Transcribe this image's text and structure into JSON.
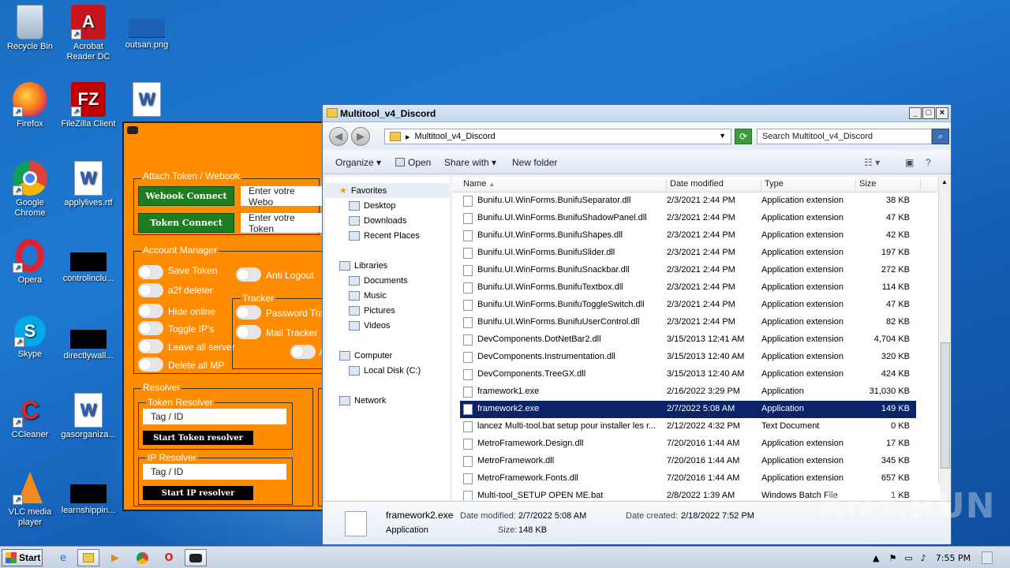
{
  "desktop": {
    "icons": [
      {
        "label": "Recycle Bin"
      },
      {
        "label": "Acrobat Reader DC"
      },
      {
        "label": "outsan.png"
      },
      {
        "label": "Firefox"
      },
      {
        "label": "FileZilla Client"
      },
      {
        "label": "Google Chrome"
      },
      {
        "label": "applylives.rtf"
      },
      {
        "label": "Opera"
      },
      {
        "label": "controlinclu..."
      },
      {
        "label": "Skype"
      },
      {
        "label": "directlywall..."
      },
      {
        "label": "CCleaner"
      },
      {
        "label": "gasorganiza..."
      },
      {
        "label": "VLC media player"
      },
      {
        "label": "learnshippin..."
      }
    ]
  },
  "tool": {
    "attach_group": "Attach Token / Webook",
    "webhook_btn": "Webook Connect",
    "webhook_placeholder": "Enter votre Webo",
    "token_btn": "Token Connect",
    "token_placeholder": "Enter votre Token",
    "account_group": "Account Manager",
    "toggles": [
      "Save Token",
      "a2f deleter",
      "Hide online",
      "Toggle IP's",
      "Leave all server",
      "Delete all MP"
    ],
    "anti_logout": "Anti Logout",
    "tracker_group": "Tracker",
    "password_tracker": "Password Trac",
    "mail_tracker": "Mail Tracker",
    "extra_toggle_label": "A",
    "resolver_group": "Resolver",
    "token_resolver_group": "Token Resolver",
    "token_resolver_input": "Tag / ID",
    "token_resolver_btn": "Start Token resolver",
    "ip_resolver_group": "IP Resolver",
    "ip_resolver_input": "Tag / ID",
    "ip_resolver_btn": "Start IP resolver"
  },
  "explorer": {
    "title": "Multitool_v4_Discord",
    "address": "Multitool_v4_Discord",
    "search_placeholder": "Search Multitool_v4_Discord",
    "commands": {
      "organize": "Organize",
      "open": "Open",
      "share": "Share with",
      "new_folder": "New folder"
    },
    "nav": {
      "favorites": "Favorites",
      "favorites_items": [
        "Desktop",
        "Downloads",
        "Recent Places"
      ],
      "libraries": "Libraries",
      "libraries_items": [
        "Documents",
        "Music",
        "Pictures",
        "Videos"
      ],
      "computer": "Computer",
      "computer_items": [
        "Local Disk (C:)"
      ],
      "network": "Network"
    },
    "columns": [
      "Name",
      "Date modified",
      "Type",
      "Size"
    ],
    "files": [
      {
        "name": "Bunifu.UI.WinForms.BunifuSeparator.dll",
        "date": "2/3/2021 2:44 PM",
        "type": "Application extension",
        "size": "38 KB"
      },
      {
        "name": "Bunifu.UI.WinForms.BunifuShadowPanel.dll",
        "date": "2/3/2021 2:44 PM",
        "type": "Application extension",
        "size": "47 KB"
      },
      {
        "name": "Bunifu.UI.WinForms.BunifuShapes.dll",
        "date": "2/3/2021 2:44 PM",
        "type": "Application extension",
        "size": "42 KB"
      },
      {
        "name": "Bunifu.UI.WinForms.BunifuSlider.dll",
        "date": "2/3/2021 2:44 PM",
        "type": "Application extension",
        "size": "197 KB"
      },
      {
        "name": "Bunifu.UI.WinForms.BunifuSnackbar.dll",
        "date": "2/3/2021 2:44 PM",
        "type": "Application extension",
        "size": "272 KB"
      },
      {
        "name": "Bunifu.UI.WinForms.BunifuTextbox.dll",
        "date": "2/3/2021 2:44 PM",
        "type": "Application extension",
        "size": "114 KB"
      },
      {
        "name": "Bunifu.UI.WinForms.BunifuToggleSwitch.dll",
        "date": "2/3/2021 2:44 PM",
        "type": "Application extension",
        "size": "47 KB"
      },
      {
        "name": "Bunifu.UI.WinForms.BunifuUserControl.dll",
        "date": "2/3/2021 2:44 PM",
        "type": "Application extension",
        "size": "82 KB"
      },
      {
        "name": "DevComponents.DotNetBar2.dll",
        "date": "3/15/2013 12:41 AM",
        "type": "Application extension",
        "size": "4,704 KB"
      },
      {
        "name": "DevComponents.Instrumentation.dll",
        "date": "3/15/2013 12:40 AM",
        "type": "Application extension",
        "size": "320 KB"
      },
      {
        "name": "DevComponents.TreeGX.dll",
        "date": "3/15/2013 12:40 AM",
        "type": "Application extension",
        "size": "424 KB"
      },
      {
        "name": "framework1.exe",
        "date": "2/16/2022 3:29 PM",
        "type": "Application",
        "size": "31,030 KB"
      },
      {
        "name": "framework2.exe",
        "date": "2/7/2022 5:08 AM",
        "type": "Application",
        "size": "149 KB"
      },
      {
        "name": "lancez Multi-tool.bat setup pour installer les r...",
        "date": "2/12/2022 4:32 PM",
        "type": "Text Document",
        "size": "0 KB"
      },
      {
        "name": "MetroFramework.Design.dll",
        "date": "7/20/2016 1:44 AM",
        "type": "Application extension",
        "size": "17 KB"
      },
      {
        "name": "MetroFramework.dll",
        "date": "7/20/2016 1:44 AM",
        "type": "Application extension",
        "size": "345 KB"
      },
      {
        "name": "MetroFramework.Fonts.dll",
        "date": "7/20/2016 1:44 AM",
        "type": "Application extension",
        "size": "657 KB"
      },
      {
        "name": "Multi-tool_SETUP OPEN ME.bat",
        "date": "2/8/2022 1:39 AM",
        "type": "Windows Batch File",
        "size": "1 KB"
      }
    ],
    "details": {
      "name": "framework2.exe",
      "type": "Application",
      "modified_label": "Date modified:",
      "modified": "2/7/2022 5:08 AM",
      "created_label": "Date created:",
      "created": "2/18/2022 7:52 PM",
      "size_label": "Size:",
      "size": "148 KB"
    }
  },
  "watermark": "ANY.RUN",
  "taskbar": {
    "start": "Start",
    "clock": "7:55 PM"
  }
}
